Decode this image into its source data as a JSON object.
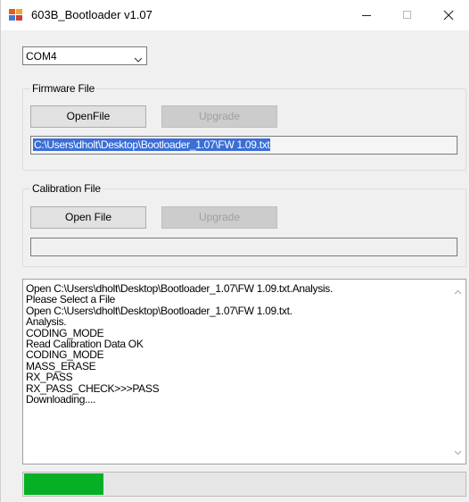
{
  "window": {
    "title": "603B_Bootloader v1.07"
  },
  "port": {
    "selected": "COM4"
  },
  "firmware": {
    "legend": "Firmware File",
    "open_label": "OpenFile",
    "upgrade_label": "Upgrade",
    "path": "C:\\Users\\dholt\\Desktop\\Bootloader_1.07\\FW 1.09.txt"
  },
  "calibration": {
    "legend": "Calibration File",
    "open_label": "Open File",
    "upgrade_label": "Upgrade",
    "path": ""
  },
  "log": {
    "lines": [
      "Open C:\\Users\\dholt\\Desktop\\Bootloader_1.07\\FW 1.09.txt.Analysis.",
      "Please Select a File",
      "Open C:\\Users\\dholt\\Desktop\\Bootloader_1.07\\FW 1.09.txt.",
      "Analysis.",
      "CODING_MODE",
      "Read Calibration Data OK",
      "CODING_MODE",
      "MASS_ERASE",
      "RX_PASS",
      "RX_PASS_CHECK>>>PASS",
      "Downloading...."
    ]
  },
  "progress": {
    "fraction": 0.18
  },
  "colors": {
    "progress_fill": "#06b025",
    "selection": "#3b6ed6"
  },
  "icons": [
    "app-icon",
    "minimize-icon",
    "maximize-icon",
    "close-icon",
    "chevron-down-icon",
    "scroll-up-icon",
    "scroll-down-icon"
  ]
}
